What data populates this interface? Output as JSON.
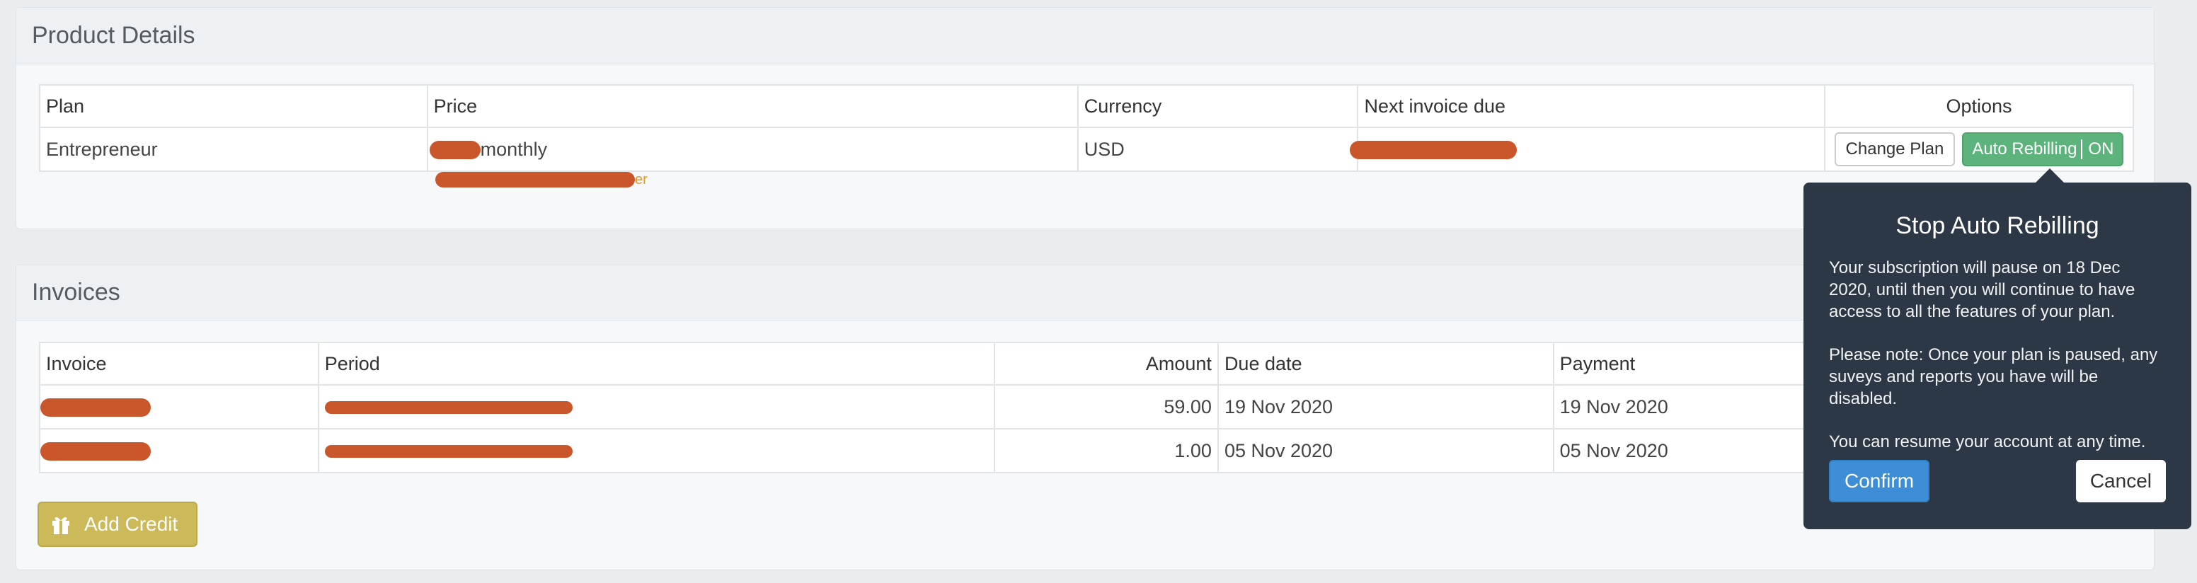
{
  "product_details": {
    "title": "Product Details",
    "columns": [
      "Plan",
      "Price",
      "Currency",
      "Next invoice due",
      "Options"
    ],
    "row": {
      "plan": "Entrepreneur",
      "price_suffix": "monthly",
      "currency": "USD",
      "note_suffix": "er"
    },
    "options": {
      "change_plan": "Change Plan",
      "auto_rebilling": "Auto Rebilling",
      "auto_rebilling_state": "ON"
    }
  },
  "invoices": {
    "title": "Invoices",
    "columns": [
      "Invoice",
      "Period",
      "Amount",
      "Due date",
      "Payment"
    ],
    "rows": [
      {
        "amount": "59.00",
        "due_date": "19 Nov 2020",
        "payment": "19 Nov 2020"
      },
      {
        "amount": "1.00",
        "due_date": "05 Nov 2020",
        "payment": "05 Nov 2020"
      }
    ],
    "add_credit": "Add Credit"
  },
  "popover": {
    "title": "Stop Auto Rebilling",
    "paragraphs": [
      "Your subscription will pause on 18 Dec 2020, until then you will continue to have access to all the features of your plan.",
      "Please note: Once your plan is paused, any suveys and reports you have will be disabled.",
      "You can resume your account at any time."
    ],
    "confirm": "Confirm",
    "cancel": "Cancel"
  },
  "colors": {
    "redaction": "#c9572b",
    "toggle_green": "#5cb47c",
    "popover_bg": "#2d3846",
    "confirm_blue": "#3d8ed6",
    "add_credit": "#cbb95a"
  },
  "icons": {
    "add_credit": "gift-icon"
  }
}
